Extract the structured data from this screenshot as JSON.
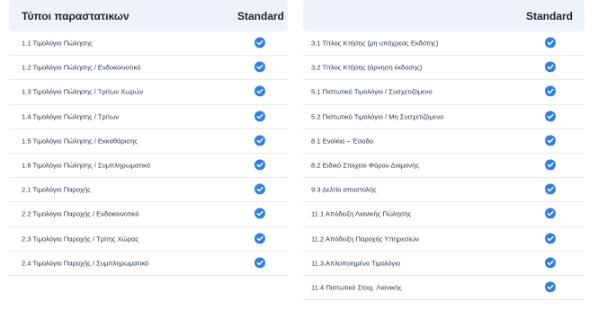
{
  "left": {
    "header": {
      "title": "Τύποι παραστατικων",
      "column": "Standard"
    },
    "rows": [
      "1.1 Τιμολόγιο Πώλησης",
      "1.2 Τιμολόγιο Πώλησης / Ενδοκοινοτικό",
      "1.3 Τιμολόγιο Πώλησης / Τρίτων Χωρών",
      "1.4 Τιμολόγιο Πώλησης / Τρίτων",
      "1.5 Τιμολόγιο Πώλησης / Εκκαθάρισης",
      "1.6 Τιμολόγιο Πώλησης / Συμπληρωματικό",
      "2.1 Τιμολόγιο Παροχής",
      "2.2 Τιμολόγιο Παροχής / Ενδοκοινοτικό",
      "2.3 Τιμολόγιο Παροχής / Τρίτης Χώρας",
      "2.4 Τιμολόγιο Παροχής / Συμπληρωματικό"
    ]
  },
  "right": {
    "header": {
      "title": "",
      "column": "Standard"
    },
    "rows": [
      "3.1 Τίτλος Κτήσης (μη υπόχρεος Εκδότης)",
      "3.2 Τίτλος Κτήσης (άρνηση έκδοσης)",
      "5.1 Πιστωτικό Τιμολόγιο / Συσχετιζόμενο",
      "5.2 Πιστωτικό Τιμολόγιο / Μη Συσχετιζόμενο",
      "8.1 Ενοίκια – Έσοδο",
      "8.2 Ειδικό Στοιχείο Φόρου Διαμονής",
      "9.3 Δελτίο αποστολής",
      "11.1 Απόδειξη Λιανικής Πώλησης",
      "11.2 Απόδειξη Παροχής Υπηρεσιών",
      "11.3 Απλοποιημένο Τιμολόγιο",
      "11.4 Πιστωτικό Στοιχ. Λιανικής"
    ]
  },
  "icons": {
    "check": "check-circle-icon"
  },
  "colors": {
    "check": "#2f7fe6",
    "header_bg": "#eef3fb",
    "divider": "#e6eaf0"
  }
}
